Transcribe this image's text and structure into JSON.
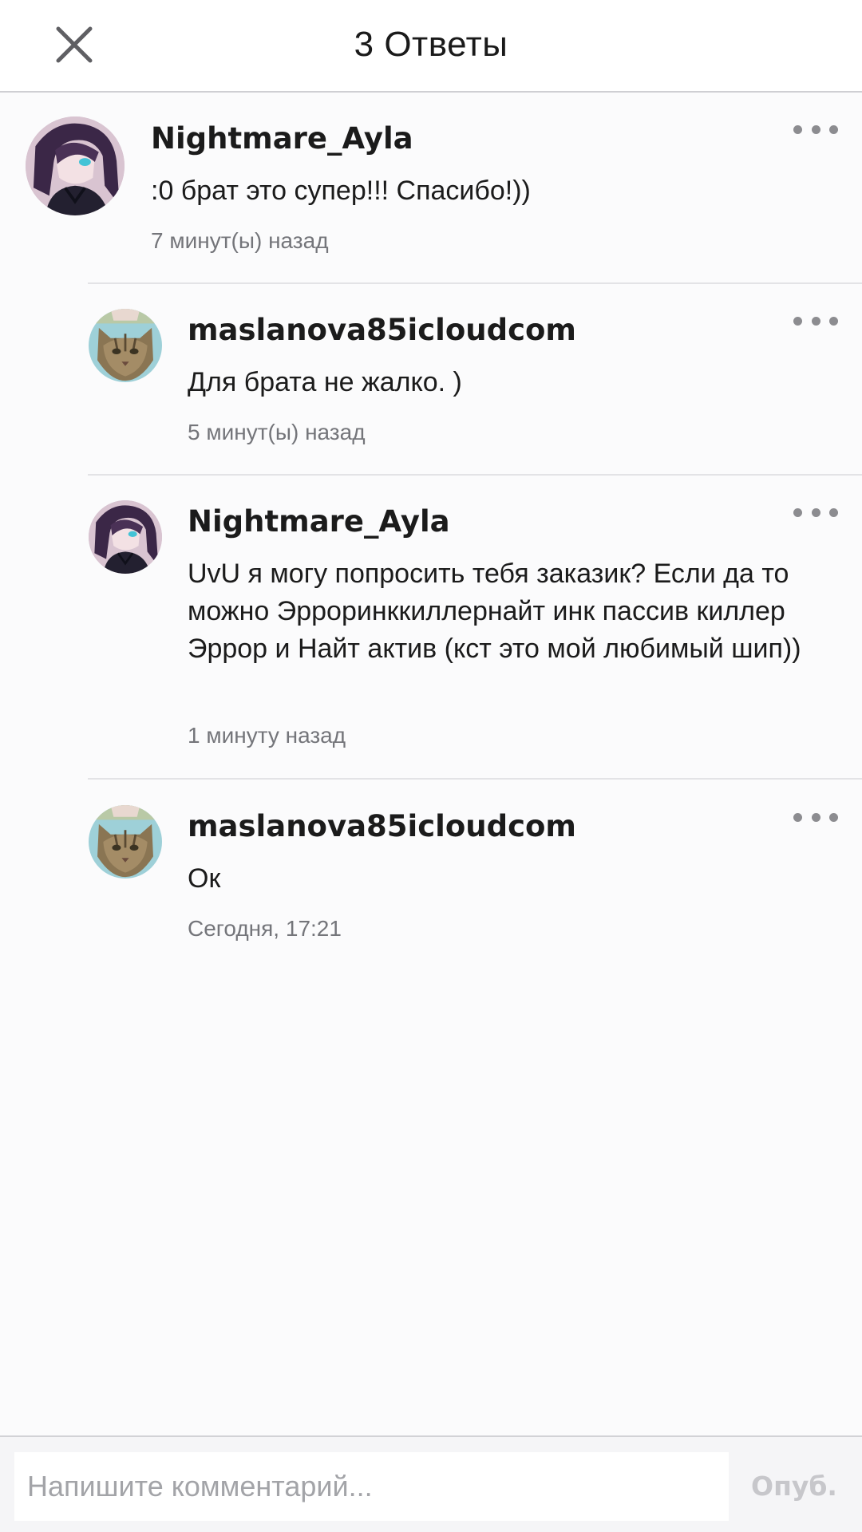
{
  "header": {
    "title": "3 Ответы",
    "close_icon": "close-icon"
  },
  "comments": [
    {
      "author": "Nightmare_Ayla",
      "avatar": "anime-girl-avatar",
      "text": ":0 брат это супер!!! Спасибо!))",
      "time": "7 минут(ы) назад"
    },
    {
      "author": "maslanova85icloudcom",
      "avatar": "cat-avatar",
      "text": "Для брата не жалко. )",
      "time": "5 минут(ы) назад"
    },
    {
      "author": "Nightmare_Ayla",
      "avatar": "anime-girl-avatar",
      "text": "UvU я могу попросить тебя заказик? Если да то можно Эрроринккиллернайт инк пассив киллер Эррор и Найт актив (кст это мой любимый шип))",
      "time": "1 минуту назад"
    },
    {
      "author": "maslanova85icloudcom",
      "avatar": "cat-avatar",
      "text": "Ок",
      "time": "Сегодня, 17:21"
    }
  ],
  "composer": {
    "placeholder": "Напишите комментарий...",
    "publish_label": "Опуб."
  },
  "colors": {
    "background": "#fbfbfc",
    "text": "#1b1b1b",
    "muted": "#74757a",
    "publish_disabled": "#c7c7cb",
    "divider": "#e3e3e6"
  }
}
